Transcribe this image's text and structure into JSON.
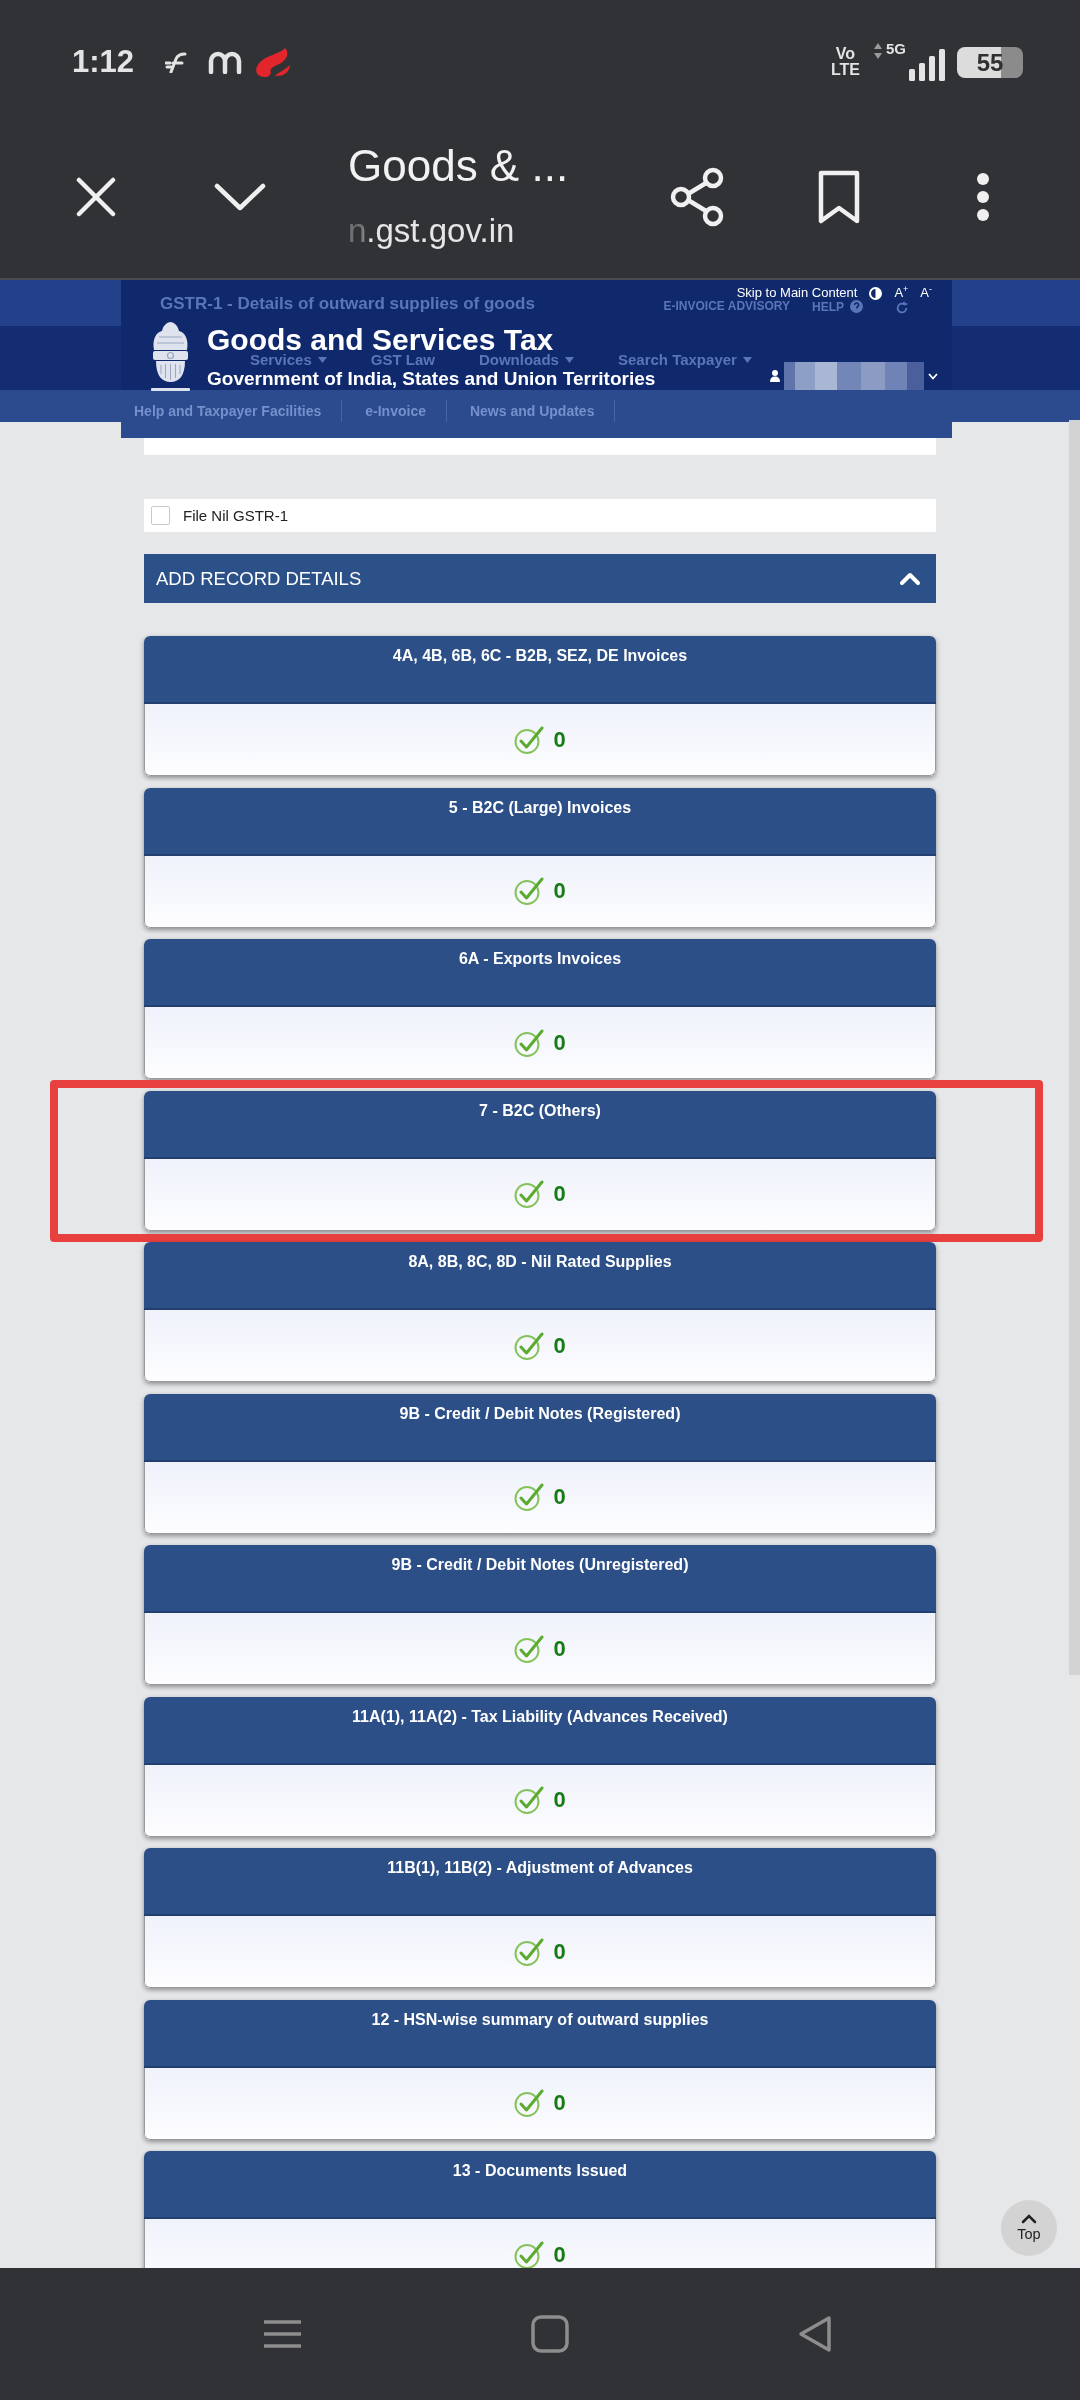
{
  "status_bar": {
    "time": "1:12",
    "volte": [
      "Vo",
      "LTE"
    ],
    "network_type": "5G",
    "battery": "55"
  },
  "browser_bar": {
    "title": "Goods & ...",
    "url": "n.gst.gov.in"
  },
  "page_behind": {
    "title": "GSTR-1 - Details of outward supplies of goods",
    "buttons": [
      {
        "label": "E-INVOICE ADVISORY",
        "kind": "text"
      },
      {
        "label": "HELP",
        "kind": "help"
      }
    ],
    "menu": [
      {
        "label": "Services",
        "dropdown": true
      },
      {
        "label": "GST Law",
        "dropdown": false
      },
      {
        "label": "Downloads",
        "dropdown": true
      },
      {
        "label": "Search Taxpayer",
        "dropdown": true
      }
    ],
    "submenu": [
      "Help and Taxpayer Facilities",
      "e-Invoice",
      "News and Updates"
    ]
  },
  "site_header": {
    "title": "Goods and Services Tax",
    "subtitle": "Government of India, States and Union Territories",
    "skip_link": "Skip to Main Content",
    "font_sizes": [
      "A$^{+}$",
      "A$^{-}$"
    ]
  },
  "nil_return": {
    "label": "File Nil GSTR-1",
    "checked": false
  },
  "section": {
    "title": "ADD RECORD DETAILS",
    "expanded": true
  },
  "tiles": [
    {
      "title": "4A, 4B, 6B, 6C - B2B, SEZ, DE Invoices",
      "count": "0",
      "highlighted": false
    },
    {
      "title": "5 - B2C (Large) Invoices",
      "count": "0",
      "highlighted": false
    },
    {
      "title": "6A - Exports Invoices",
      "count": "0",
      "highlighted": false
    },
    {
      "title": "7 - B2C (Others)",
      "count": "0",
      "highlighted": true
    },
    {
      "title": "8A, 8B, 8C, 8D - Nil Rated Supplies",
      "count": "0",
      "highlighted": false
    },
    {
      "title": "9B - Credit / Debit Notes (Registered)",
      "count": "0",
      "highlighted": false
    },
    {
      "title": "9B - Credit / Debit Notes (Unregistered)",
      "count": "0",
      "highlighted": false
    },
    {
      "title": "11A(1), 11A(2) - Tax Liability (Advances Received)",
      "count": "0",
      "highlighted": false
    },
    {
      "title": "11B(1), 11B(2) - Adjustment of Advances",
      "count": "0",
      "highlighted": false
    },
    {
      "title": "12 - HSN-wise summary of outward supplies",
      "count": "0",
      "highlighted": false
    },
    {
      "title": "13 - Documents Issued",
      "count": "0",
      "highlighted": false
    }
  ],
  "top_button": {
    "label": "Top"
  }
}
